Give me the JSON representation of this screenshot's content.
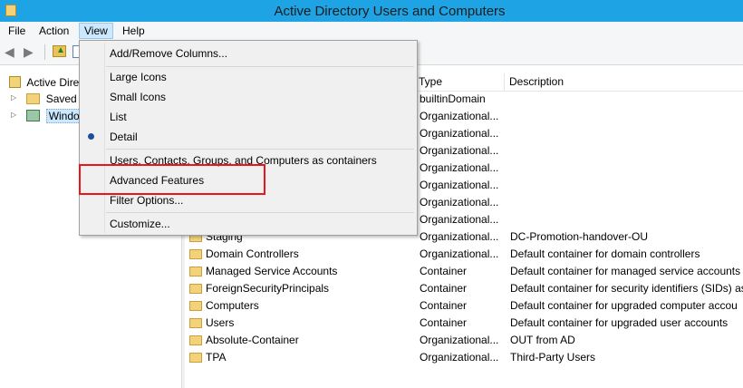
{
  "window": {
    "title": "Active Directory Users and Computers"
  },
  "menubar": {
    "items": [
      "File",
      "Action",
      "View",
      "Help"
    ]
  },
  "tree": {
    "root_label": "Active Dire",
    "children": [
      {
        "label": "Saved Q"
      },
      {
        "label": "Window"
      }
    ]
  },
  "list": {
    "columns": [
      "Type",
      "Description"
    ],
    "rows": [
      {
        "name": "",
        "type": "builtinDomain",
        "description": ""
      },
      {
        "name": "",
        "type": "Organizational...",
        "description": ""
      },
      {
        "name": "",
        "type": "Organizational...",
        "description": ""
      },
      {
        "name": "",
        "type": "Organizational...",
        "description": ""
      },
      {
        "name": "",
        "type": "Organizational...",
        "description": ""
      },
      {
        "name": "",
        "type": "Organizational...",
        "description": ""
      },
      {
        "name": "",
        "type": "Organizational...",
        "description": ""
      },
      {
        "name": "",
        "type": "Organizational...",
        "description": ""
      },
      {
        "name": "Staging",
        "type": "Organizational...",
        "description": "DC-Promotion-handover-OU"
      },
      {
        "name": "Domain Controllers",
        "type": "Organizational...",
        "description": "Default container for domain controllers"
      },
      {
        "name": "Managed Service Accounts",
        "type": "Container",
        "description": "Default container for managed service accounts"
      },
      {
        "name": "ForeignSecurityPrincipals",
        "type": "Container",
        "description": "Default container for security identifiers (SIDs) ass"
      },
      {
        "name": "Computers",
        "type": "Container",
        "description": "Default container for upgraded computer accou"
      },
      {
        "name": "Users",
        "type": "Container",
        "description": "Default container for upgraded user accounts"
      },
      {
        "name": "Absolute-Container",
        "type": "Organizational...",
        "description": "OUT from AD"
      },
      {
        "name": "TPA",
        "type": "Organizational...",
        "description": "Third-Party Users"
      }
    ]
  },
  "view_menu": {
    "add_remove_columns": "Add/Remove Columns...",
    "large_icons": "Large Icons",
    "small_icons": "Small Icons",
    "list": "List",
    "detail": "Detail",
    "users_as_containers": "Users, Contacts, Groups, and Computers as containers",
    "advanced_features": "Advanced Features",
    "filter_options": "Filter Options...",
    "customize": "Customize...",
    "selected": "Detail"
  },
  "colors": {
    "titlebar": "#1ea4e4",
    "highlight": "#e8171b",
    "menu_open": "#cce8ff"
  }
}
